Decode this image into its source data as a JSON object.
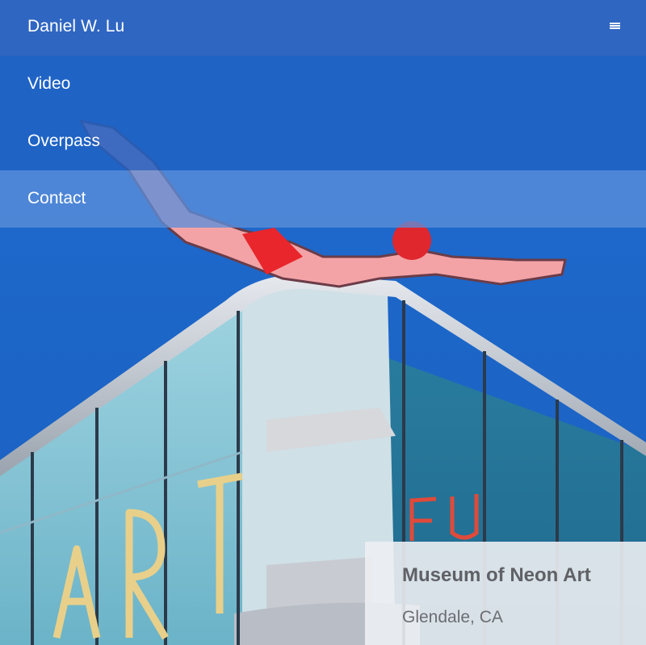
{
  "header": {
    "site_title": "Daniel W. Lu",
    "menu_icon": "hamburger-icon"
  },
  "nav": {
    "items": [
      {
        "label": "Video"
      },
      {
        "label": "Overpass"
      },
      {
        "label": "Contact",
        "active": true
      }
    ]
  },
  "caption": {
    "title": "Museum of Neon Art",
    "location": "Glendale, CA"
  },
  "colors": {
    "header_bg": "#2f66c2",
    "nav_bg": "#2062c4",
    "nav_active_bg": "#5c8eda",
    "sky": "#1b66c9",
    "caption_bg": "#eceef2"
  }
}
